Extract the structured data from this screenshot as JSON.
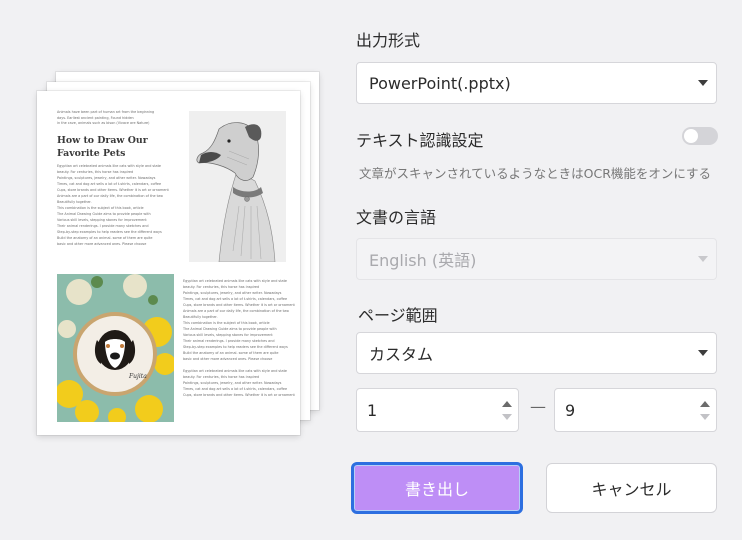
{
  "preview": {
    "intro_lines": [
      "Animals have been part of human art from the beginning",
      "days. Earliest ancient painting, Found hidden",
      "in the cave, animals such as bison (Vivace are Nature)"
    ],
    "title_line1": "How to Draw Our",
    "title_line2": "Favorite Pets",
    "body_lines": [
      "Egyptian art celebrated animals like cats with style and state",
      "beauty. For centuries, this horse has inspired",
      "Paintings, sculptures, jewelry, and other writer. Nowadays",
      "Times, cat and dog art sells a lot of t-shirts, calendars, coffee",
      "Cups, store brands and other items. Whether it is art or ornament",
      "Animals are a part of our daily life, the combination of the two",
      "Beautifully together.",
      "This combination is the subject of this book, article",
      "The Animal Drawing Guide aims to provide people with",
      "Various skill levels, stepping stones for improvement",
      "Their animal renderings. I provide many sketches and",
      "Step-by-step examples to help readers see the different ways",
      "Build the anatomy of an animal. some of them are quite",
      "basic and other more advanced ones. Please choose"
    ],
    "right_lines": [
      "Egyptian art celebrated animals like cats with style and state",
      "beauty. For centuries, this horse has inspired",
      "Paintings, sculptures, jewelry, and other writer. Nowadays",
      "Times, cat and dog art sells a lot of t-shirts, calendars, coffee",
      "Cups, store brands and other items. Whether it is art or ornament",
      "Animals are a part of our daily life, the combination of the two",
      "Beautifully together.",
      "This combination is the subject of this book, article",
      "The Animal Drawing Guide aims to provide people with",
      "Various skill levels, stepping stones for improvement",
      "Their animal renderings. I provide many sketches and",
      "Step-by-step examples to help readers see the different ways",
      "Build the anatomy of an animal. some of them are quite",
      "basic and other more advanced ones. Please choose",
      "",
      "Egyptian art celebrated animals like cats with style and state",
      "beauty. For centuries, this horse has inspired",
      "Paintings, sculptures, jewelry, and other writer. Nowadays",
      "Times, cat and dog art sells a lot of t-shirts, calendars, coffee",
      "Cups, store brands and other items. Whether it is art or ornament"
    ],
    "hoop_signature": "Fujita"
  },
  "output_format": {
    "label": "出力形式",
    "value": "PowerPoint(.pptx)"
  },
  "ocr": {
    "label": "テキスト認識設定",
    "enabled": false,
    "hint": "文章がスキャンされているようなときはOCR機能をオンにする"
  },
  "language": {
    "label": "文書の言語",
    "value": "English (英語)",
    "disabled": true
  },
  "page_range": {
    "label": "ページ範囲",
    "mode": "カスタム",
    "from": "1",
    "to": "9",
    "separator": "—"
  },
  "buttons": {
    "export": "書き出し",
    "cancel": "キャンセル"
  },
  "colors": {
    "primary": "#be8ef6",
    "focus_ring": "#2d6fe0",
    "background": "#f1f1f3"
  }
}
